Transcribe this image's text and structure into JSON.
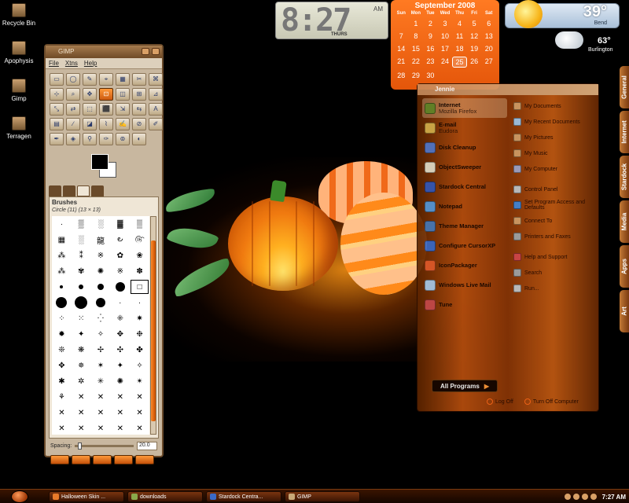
{
  "desktop_icons": [
    {
      "label": "Recycle Bin"
    },
    {
      "label": "Apophysis"
    },
    {
      "label": "Gimp"
    },
    {
      "label": "Terragen"
    }
  ],
  "clock": {
    "time": "8:27",
    "ampm": "AM",
    "day": "THURS"
  },
  "calendar": {
    "title": "September 2008",
    "dow": [
      "Sun",
      "Mon",
      "Tue",
      "Wed",
      "Thu",
      "Fri",
      "Sat"
    ],
    "rows": [
      [
        "",
        "1",
        "2",
        "3",
        "4",
        "5",
        "6"
      ],
      [
        "7",
        "8",
        "9",
        "10",
        "11",
        "12",
        "13"
      ],
      [
        "14",
        "15",
        "16",
        "17",
        "18",
        "19",
        "20"
      ],
      [
        "21",
        "22",
        "23",
        "24",
        "25",
        "26",
        "27"
      ],
      [
        "28",
        "29",
        "30",
        "",
        "",
        "",
        ""
      ]
    ],
    "today": "25"
  },
  "weather": {
    "temp1": "39°",
    "city1": "Bend",
    "temp2": "63°",
    "city2": "Burlington"
  },
  "side_tabs": [
    "General",
    "Internet",
    "Stardock",
    "Media",
    "Apps",
    "Art"
  ],
  "gimp": {
    "title": "GIMP",
    "menu": [
      "File",
      "Xtns",
      "Help"
    ],
    "tool_glyphs": [
      "▭",
      "◯",
      "✎",
      "⌖",
      "▦",
      "✂",
      "⌘",
      "⊹",
      "⌕",
      "✥",
      "⊡",
      "◫",
      "⊞",
      "⊿",
      "⤡",
      "⇄",
      "⬚",
      "⬛",
      "⇲",
      "⇆",
      "A",
      "▤",
      "∕",
      "◪",
      "⌇",
      "✍",
      "⊘",
      "✐",
      "✒",
      "◈",
      "⚲",
      "✑",
      "⊚",
      "◐"
    ],
    "active_tool": 10,
    "brushes_label": "Brushes",
    "brush_info": "Circle (11) (13 × 13)",
    "brush_glyphs": [
      "·",
      "▒",
      "░",
      "▓",
      "▒",
      "▦",
      "░",
      "龍",
      "౿",
      "௹",
      "⁂",
      "⁑",
      "※",
      "✿",
      "❀",
      "⁂",
      "✾",
      "✺",
      "※",
      "✽",
      "•",
      "•",
      "•",
      "●",
      "□",
      "●",
      "●",
      "●",
      "·",
      "·",
      "⁘",
      "⁙",
      "⁛",
      "⁜",
      "✷",
      "✹",
      "✦",
      "✧",
      "✥",
      "❉",
      "❊",
      "❋",
      "✢",
      "✣",
      "✤",
      "✥",
      "✵",
      "✶",
      "✦",
      "✧",
      "✱",
      "✲",
      "✳",
      "✺",
      "✴",
      "⚘",
      "✕",
      "✕",
      "✕",
      "✕",
      "✕",
      "✕",
      "✕",
      "✕",
      "✕",
      "✕",
      "✕",
      "✕",
      "✕",
      "✕"
    ],
    "spacing_label": "Spacing:",
    "spacing_value": "20.0"
  },
  "start_menu": {
    "user": "Jennie",
    "left_items": [
      {
        "title": "Internet",
        "sub": "Mozilla Firefox"
      },
      {
        "title": "E-mail",
        "sub": "Eudora"
      },
      {
        "title": "Disk Cleanup",
        "sub": ""
      },
      {
        "title": "ObjectSweeper",
        "sub": ""
      },
      {
        "title": "Stardock Central",
        "sub": ""
      },
      {
        "title": "Notepad",
        "sub": ""
      },
      {
        "title": "Theme Manager",
        "sub": ""
      },
      {
        "title": "Configure CursorXP",
        "sub": ""
      },
      {
        "title": "IconPackager",
        "sub": ""
      },
      {
        "title": "Windows Live Mail",
        "sub": ""
      },
      {
        "title": "Tune",
        "sub": ""
      }
    ],
    "right_items": [
      {
        "label": "My Documents"
      },
      {
        "label": "My Recent Documents"
      },
      {
        "label": "My Pictures"
      },
      {
        "label": "My Music"
      },
      {
        "label": "My Computer"
      },
      {
        "label": "Control Panel"
      },
      {
        "label": "Set Program Access and Defaults"
      },
      {
        "label": "Connect To"
      },
      {
        "label": "Printers and Faxes"
      },
      {
        "label": "Help and Support"
      },
      {
        "label": "Search"
      },
      {
        "label": "Run..."
      }
    ],
    "all_programs": "All Programs",
    "log_off": "Log Off",
    "turn_off": "Turn Off Computer"
  },
  "taskbar": {
    "items": [
      {
        "label": "Halloween Skin ..."
      },
      {
        "label": "downloads"
      },
      {
        "label": "Stardock Centra..."
      },
      {
        "label": "GIMP"
      }
    ],
    "time": "7:27 AM"
  },
  "colors": {
    "accent": "#e4560a",
    "gimp_frame": "#6a4a2a",
    "start_bg": "#b84f0e"
  }
}
